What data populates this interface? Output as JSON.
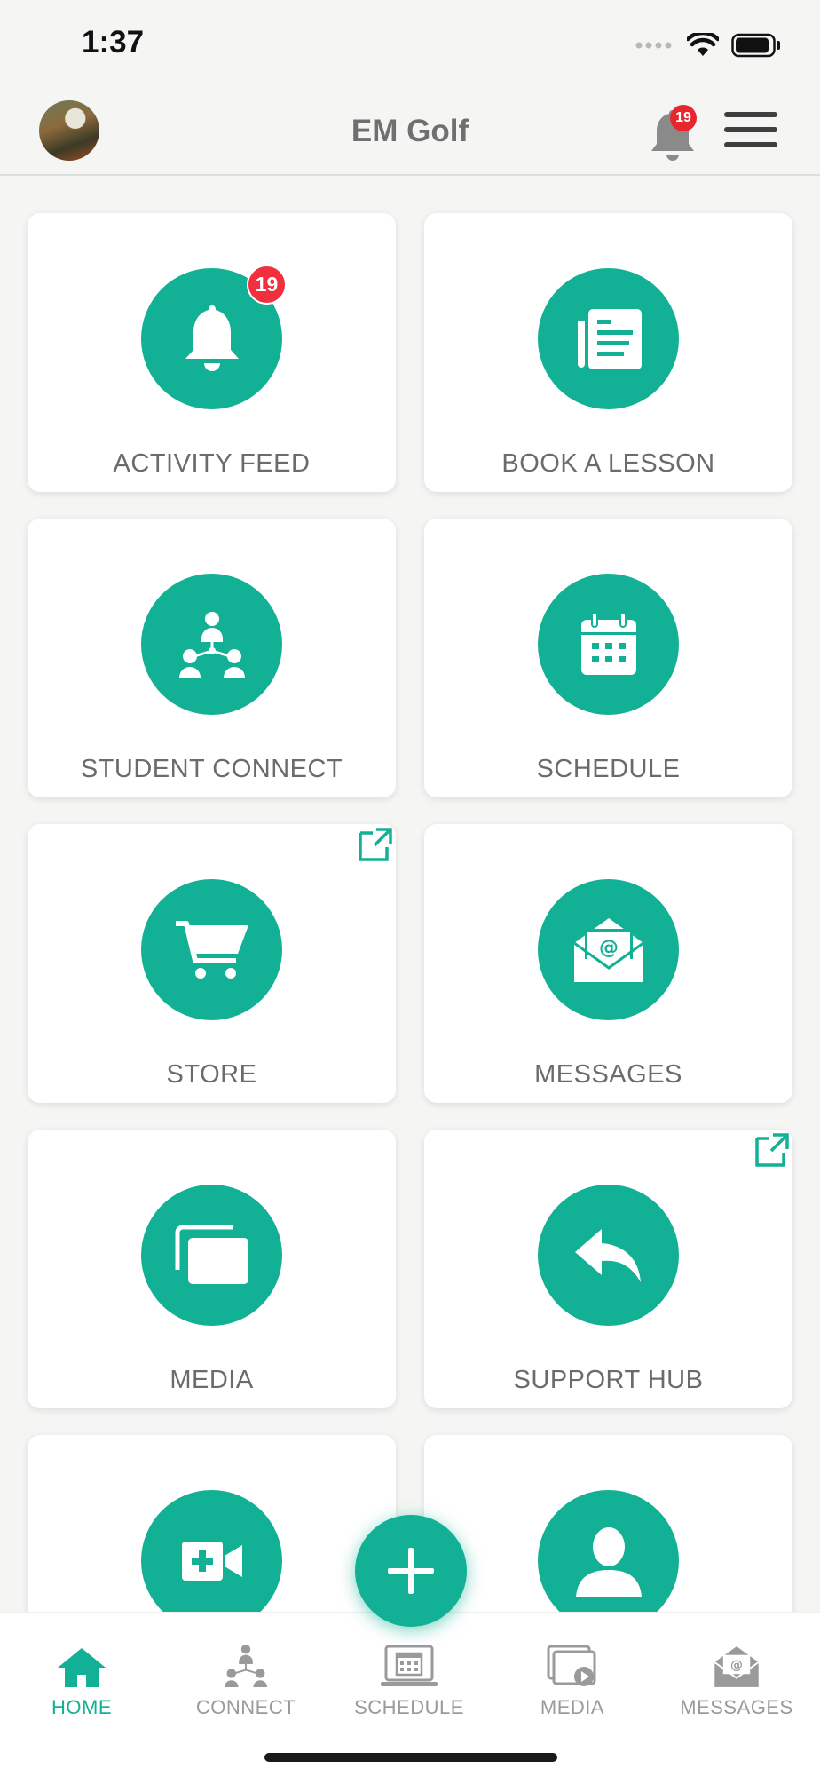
{
  "status_bar": {
    "time": "1:37"
  },
  "header": {
    "title": "EM Golf",
    "notification_count": "19"
  },
  "tiles": [
    {
      "label": "ACTIVITY FEED",
      "icon": "bell-icon",
      "badge": "19"
    },
    {
      "label": "BOOK A LESSON",
      "icon": "newspaper-icon"
    },
    {
      "label": "STUDENT CONNECT",
      "icon": "network-people-icon"
    },
    {
      "label": "SCHEDULE",
      "icon": "calendar-icon"
    },
    {
      "label": "STORE",
      "icon": "cart-icon",
      "external": true
    },
    {
      "label": "MESSAGES",
      "icon": "envelope-at-icon"
    },
    {
      "label": "MEDIA",
      "icon": "media-stack-icon"
    },
    {
      "label": "SUPPORT HUB",
      "icon": "reply-arrow-icon",
      "external": true
    },
    {
      "label": "",
      "icon": "video-add-icon"
    },
    {
      "label": "",
      "icon": "person-silhouette-icon"
    }
  ],
  "bottom_nav": [
    {
      "label": "HOME",
      "icon": "home-icon",
      "active": true
    },
    {
      "label": "CONNECT",
      "icon": "network-people-icon",
      "active": false
    },
    {
      "label": "SCHEDULE",
      "icon": "calendar-icon",
      "active": false
    },
    {
      "label": "MEDIA",
      "icon": "media-play-icon",
      "active": false
    },
    {
      "label": "MESSAGES",
      "icon": "envelope-at-icon",
      "active": false
    }
  ],
  "colors": {
    "accent": "#12b094",
    "badge": "#f0303e",
    "background": "#f5f5f4",
    "text": "#6b6b6b"
  }
}
